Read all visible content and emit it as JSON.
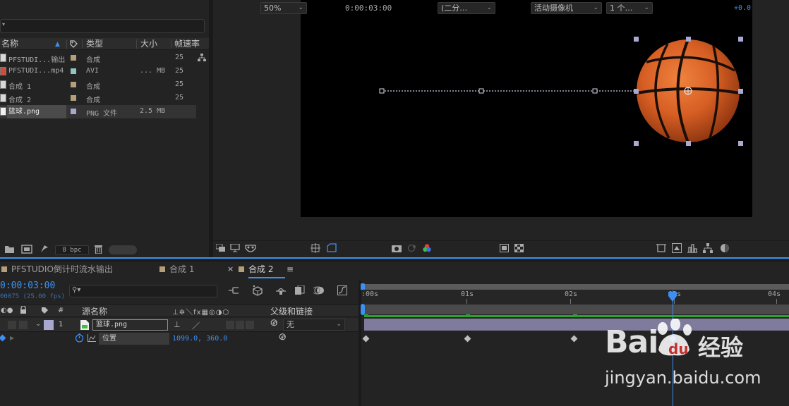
{
  "project": {
    "columns": {
      "name": "名称",
      "type": "类型",
      "size": "大小",
      "fps": "帧速率"
    },
    "items": [
      {
        "name": "PFSTUDI...输出",
        "type": "合成",
        "size": "",
        "fps": "25",
        "swatch": "#b3a07a",
        "icon": "composition-icon"
      },
      {
        "name": "PFSTUDI...mp4",
        "type": "AVI",
        "size": "... MB",
        "fps": "25",
        "swatch": "#8fc5c0",
        "icon": "video-file-icon"
      },
      {
        "name": "合成 1",
        "type": "合成",
        "size": "",
        "fps": "25",
        "swatch": "#b3a07a",
        "icon": "composition-icon"
      },
      {
        "name": "合成 2",
        "type": "合成",
        "size": "",
        "fps": "25",
        "swatch": "#b3a07a",
        "icon": "composition-icon"
      },
      {
        "name": "篮球.png",
        "type": "PNG 文件",
        "size": "2.5 MB",
        "fps": "",
        "swatch": "#a7a7cf",
        "icon": "image-file-icon"
      }
    ],
    "bpc": "8 bpc"
  },
  "viewer": {
    "zoom": "50%",
    "timecode": "0:00:03:00",
    "resolution": "(二分…",
    "camera": "活动摄像机",
    "views": "1 个…",
    "exposure": "+0.0"
  },
  "timeline": {
    "tabs": [
      {
        "label": "PFSTUDIO倒计时流水输出",
        "swatch": "#b3a07a"
      },
      {
        "label": "合成 1",
        "swatch": "#b3a07a"
      },
      {
        "label": "合成 2",
        "swatch": "#b3a07a",
        "active": true
      }
    ],
    "timecode": "0:00:03:00",
    "fps_line": "00075 (25.00 fps)",
    "col_source_name": "源名称",
    "col_parent": "父级和链接",
    "layer": {
      "index": "1",
      "name": "篮球.png",
      "parent": "无"
    },
    "property": {
      "name": "位置",
      "value": "1099.0, 360.0"
    },
    "ruler": [
      ":00s",
      "01s",
      "02s",
      "03s",
      "04s"
    ]
  },
  "watermark": {
    "brand": "Bai",
    "brand2": "经验",
    "url": "jingyan.baidu.com"
  }
}
